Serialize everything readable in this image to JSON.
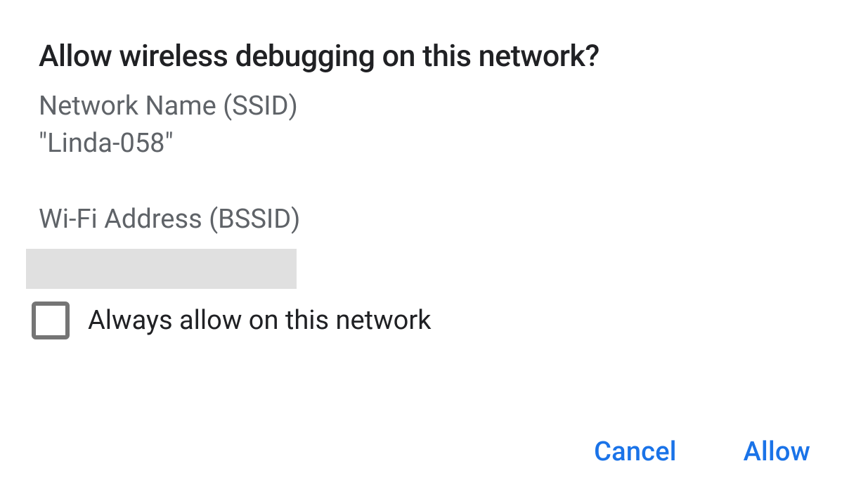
{
  "dialog": {
    "title": "Allow wireless debugging on this network?",
    "ssid_label": "Network Name (SSID)",
    "ssid_value": "\"Linda-058\"",
    "bssid_label": "Wi-Fi Address (BSSID)",
    "checkbox_label": "Always allow on this network",
    "checkbox_checked": false,
    "buttons": {
      "cancel": "Cancel",
      "allow": "Allow"
    }
  }
}
